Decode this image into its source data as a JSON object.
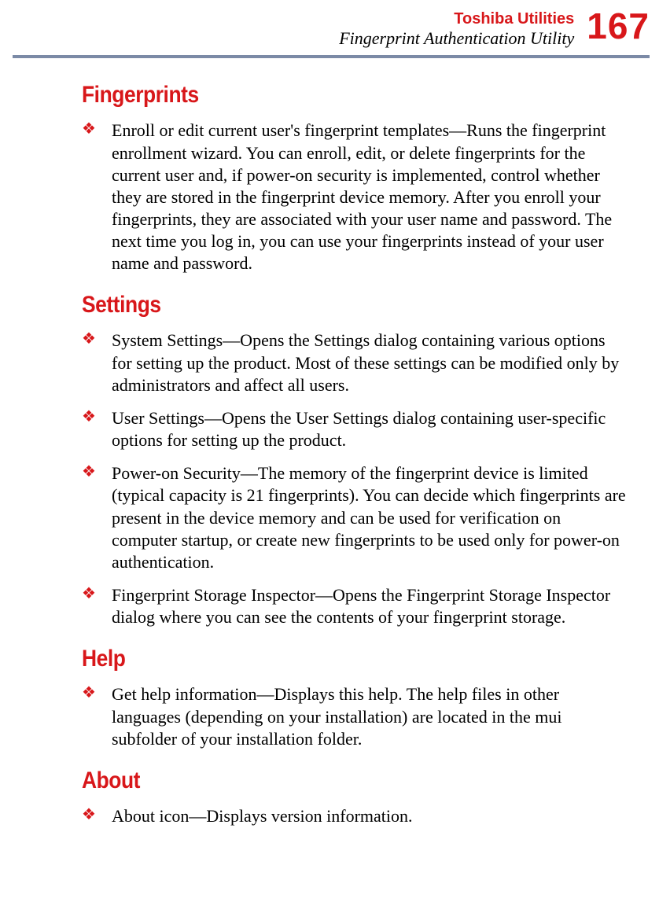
{
  "header": {
    "chapter": "Toshiba Utilities",
    "subtitle": "Fingerprint Authentication Utility",
    "page_number": "167"
  },
  "sections": {
    "fingerprints": {
      "heading": "Fingerprints",
      "items": [
        "Enroll or edit current user's fingerprint templates—Runs the fingerprint enrollment wizard. You can enroll, edit, or delete fingerprints for the current user and, if power-on security is implemented, control whether they are stored in the fingerprint device memory. After you enroll your fingerprints, they are associated with your user name and password. The next time you log in, you can use your fingerprints instead of your user name and password."
      ]
    },
    "settings": {
      "heading": "Settings",
      "items": [
        "System Settings—Opens the Settings dialog containing various options for setting up the product. Most of these settings can be modified only by administrators and affect all users.",
        "User Settings—Opens the User Settings dialog containing user-specific options for setting up the product.",
        "Power-on Security—The memory of the fingerprint device is limited (typical capacity is 21 fingerprints). You can decide which fingerprints are present in the device memory and can be used for verification on computer startup, or create new fingerprints to be used only for power-on authentication.",
        "Fingerprint Storage Inspector—Opens the Fingerprint Storage Inspector dialog where you can see the contents of your fingerprint storage."
      ]
    },
    "help": {
      "heading": "Help",
      "items": [
        "Get help information—Displays this help. The help files in other languages (depending on your installation) are located in the mui subfolder of your installation folder."
      ]
    },
    "about": {
      "heading": "About",
      "items": [
        "About icon—Displays version information."
      ]
    }
  }
}
